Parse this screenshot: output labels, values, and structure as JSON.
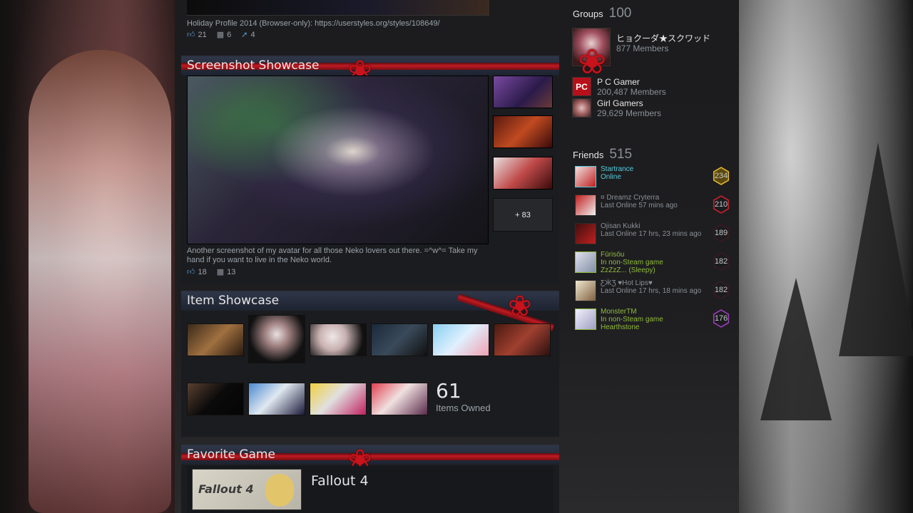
{
  "previous_post": {
    "text": "Holiday Profile 2014 (Browser-only): https://userstyles.org/styles/108649/",
    "likes": "21",
    "comments": "6",
    "shares": "4"
  },
  "screenshot_showcase": {
    "title": "Screenshot Showcase",
    "more": "+ 83",
    "caption": "Another screenshot of my avatar for all those Neko lovers out there. =^w^= Take my hand if you want to live in the Neko world.",
    "likes": "18",
    "comments": "13"
  },
  "item_showcase": {
    "title": "Item Showcase",
    "count": "61",
    "count_label": "Items Owned"
  },
  "favorite_game": {
    "title": "Favorite Game",
    "name": "Fallout 4",
    "logo_text": "Fallout 4"
  },
  "groups": {
    "label": "Groups",
    "count": "100",
    "items": [
      {
        "name": "ヒョクーダ★スクワッド",
        "members": "877 Members"
      },
      {
        "name": "P C Gamer",
        "members": "200,487 Members"
      },
      {
        "name": "Girl Gamers",
        "members": "29,629 Members"
      }
    ]
  },
  "friends": {
    "label": "Friends",
    "count": "515",
    "items": [
      {
        "name": "Startrance",
        "status": "Online",
        "status2": "",
        "level": "234",
        "state": "online",
        "level_color": "#e0b22a"
      },
      {
        "name": "¤ Dreamz Cryterra",
        "status": "Last Online 57 mins ago",
        "status2": "",
        "level": "210",
        "state": "offline",
        "level_color": "#c5202b"
      },
      {
        "name": "Ojisan Kukki",
        "status": "Last Online 17 hrs, 23 mins ago",
        "status2": "",
        "level": "189",
        "state": "offline",
        "level_color": "#3a1a20"
      },
      {
        "name": "Fūrisōu",
        "status": "In non-Steam game",
        "status2": "ZzZzZ... (Sleepy)",
        "level": "182",
        "state": "ingame",
        "level_color": "#3a1a20"
      },
      {
        "name": "ƸӜƷ ♥Hot Lips♥",
        "status": "Last Online 17 hrs, 18 mins ago",
        "status2": "",
        "level": "182",
        "state": "offline",
        "level_color": "#3a1a20"
      },
      {
        "name": "MonsterTM",
        "status": "In non-Steam game",
        "status2": "Hearthstone",
        "level": "176",
        "state": "ingame",
        "level_color": "#9b3db8"
      }
    ]
  },
  "colors": {
    "ribbon": "#c01a22",
    "online": "#57cbde",
    "ingame": "#90ba3c",
    "offline": "#8a8f96"
  }
}
